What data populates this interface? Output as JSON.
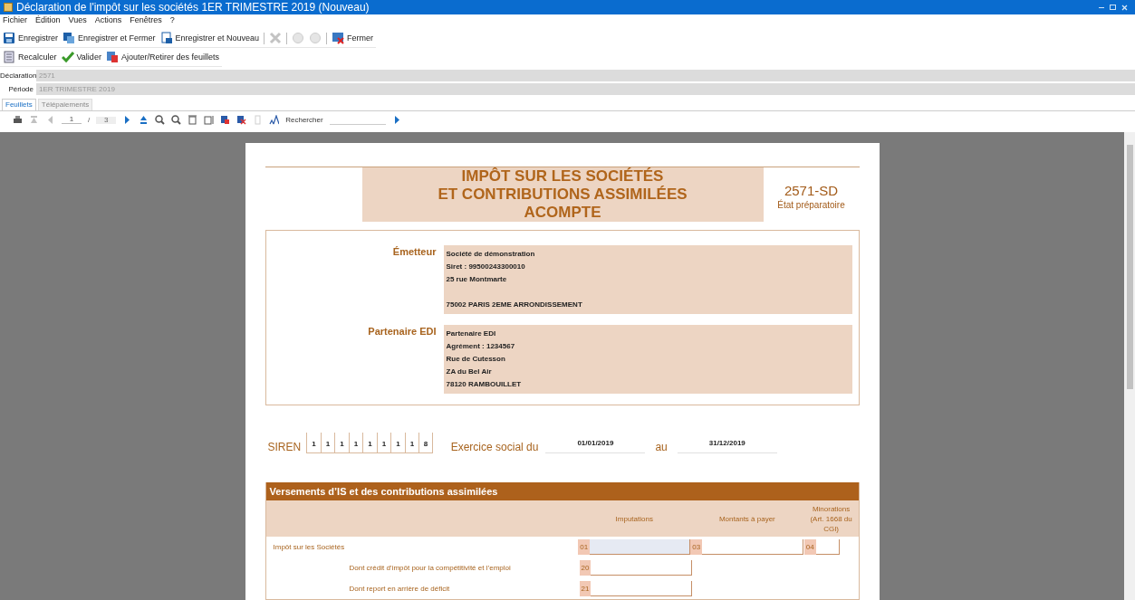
{
  "window": {
    "title": "Déclaration de l'impôt sur les sociétés 1ER TRIMESTRE 2019 (Nouveau)"
  },
  "menu": [
    "Fichier",
    "Édition",
    "Vues",
    "Actions",
    "Fenêtres",
    "?"
  ],
  "toolbar": [
    {
      "kind": "button",
      "label": "Enregistrer"
    },
    {
      "kind": "button",
      "label": "Enregistrer et Fermer"
    },
    {
      "kind": "button",
      "label": "Enregistrer et Nouveau"
    },
    {
      "kind": "separator"
    },
    {
      "kind": "icon",
      "disabled": true
    },
    {
      "kind": "separator"
    },
    {
      "kind": "icon",
      "disabled": true
    },
    {
      "kind": "icon",
      "disabled": true
    },
    {
      "kind": "separator"
    },
    {
      "kind": "button",
      "label": "Fermer"
    }
  ],
  "toolbar2": [
    {
      "label": "Recalculer"
    },
    {
      "label": "Valider"
    },
    {
      "label": "Ajouter/Retirer des feuillets"
    }
  ],
  "fields": [
    {
      "label": "Déclaration",
      "value": "2571"
    },
    {
      "label": "Période",
      "value": "1ER TRIMESTRE 2019"
    }
  ],
  "tabs": [
    {
      "label": "Feuillets",
      "selected": true
    },
    {
      "label": "Télépaiements",
      "selected": false
    }
  ],
  "viewer": {
    "page": "1",
    "separator": "/",
    "pages": "3",
    "search_label": "Rechercher"
  },
  "form": {
    "title_lines": [
      "IMPÔT SUR LES SOCIÉTÉS",
      "ET CONTRIBUTIONS ASSIMILÉES",
      "ACOMPTE"
    ],
    "code": "2571-SD",
    "subtitle": "État préparatoire",
    "parties": [
      {
        "label": "Émetteur",
        "blocks": [
          [
            "Société de démonstration",
            "Siret : 99500243300010",
            "25 rue Montmarte"
          ],
          [
            "75002 PARIS 2EME ARRONDISSEMENT"
          ]
        ]
      },
      {
        "label": "Partenaire EDI",
        "blocks": [
          [
            "Partenaire EDI",
            "Agrément : 1234567",
            "Rue de Cutesson",
            "ZA du Bel Air",
            "78120 RAMBOUILLET"
          ]
        ]
      }
    ],
    "siren_label": "SIREN",
    "siren": [
      "1",
      "1",
      "1",
      "1",
      "1",
      "1",
      "1",
      "1",
      "8"
    ],
    "exercice_label": "Exercice social du",
    "date_from": "01/01/2019",
    "au_label": "au",
    "date_to": "31/12/2019",
    "section_title": "Versements d’IS et des contributions assimilées",
    "columns": [
      "Imputations",
      "Montants à payer",
      "Minorations (Art. 1668 du CGI)"
    ],
    "rows": [
      {
        "label": "Impôt sur les Sociétés",
        "cells": [
          {
            "code": "01",
            "highlighted": true
          },
          {
            "code": "03",
            "highlighted": false
          },
          {
            "code": "04",
            "highlighted": false
          }
        ],
        "children": [
          {
            "label": "Dont crédit d’impôt pour la compétitivité et l’emploi",
            "cells": [
              {
                "code": "20",
                "highlighted": false
              }
            ]
          },
          {
            "label": "Dont report en arrière de déficit",
            "cells": [
              {
                "code": "21",
                "highlighted": false
              }
            ]
          }
        ]
      }
    ]
  }
}
